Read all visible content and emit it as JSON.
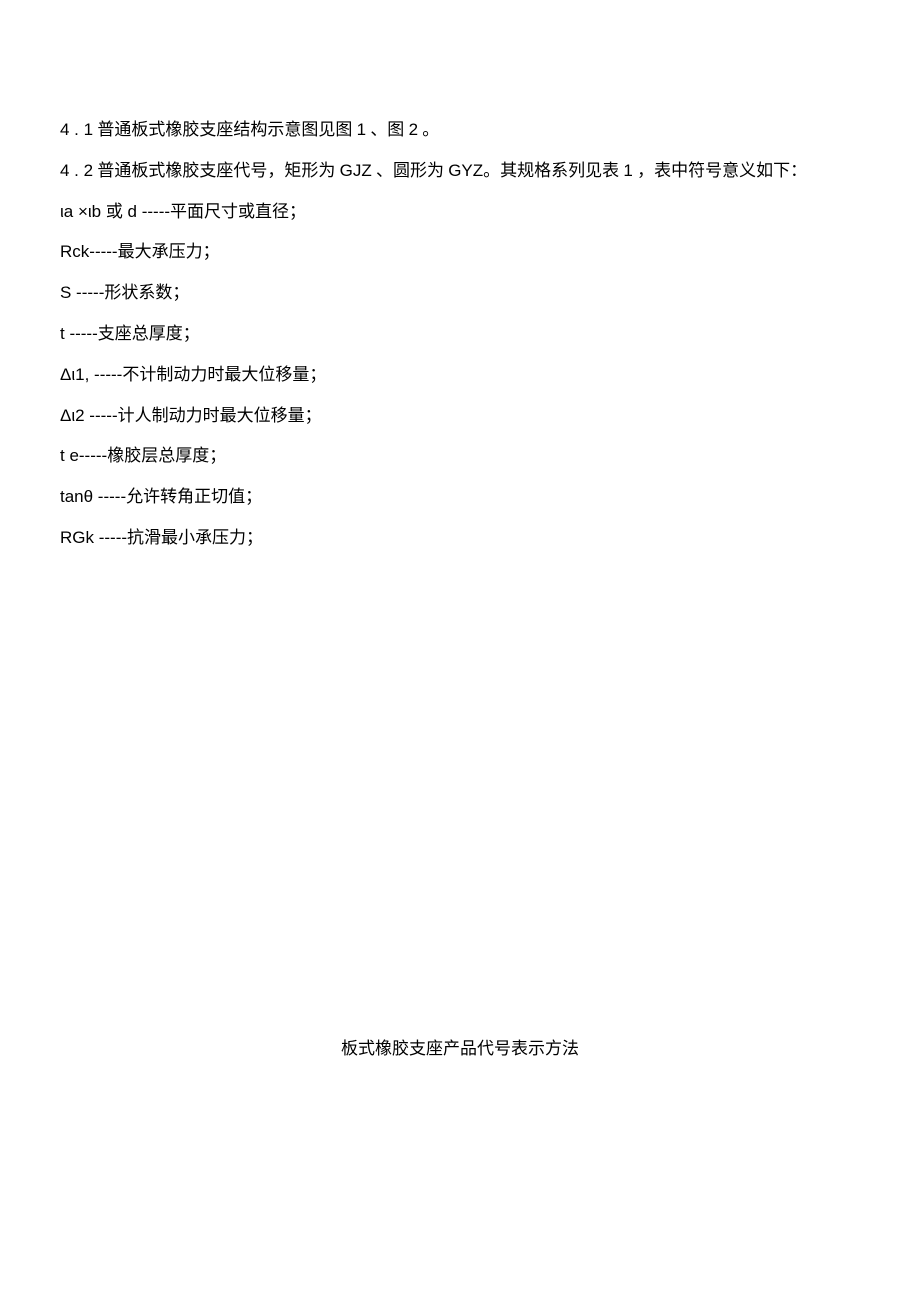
{
  "section_4_1": {
    "number": "4 . 1",
    "text_before": " 普通板式橡胶支座结构示意图见图 ",
    "fig1": "1",
    "separator": " 、图 ",
    "fig2": "2",
    "period": " 。"
  },
  "section_4_2": {
    "number": "4 . 2",
    "text_before": " 普通板式橡胶支座代号，矩形为 ",
    "code1": "GJZ",
    "mid1": " 、圆形为 ",
    "code2": "GYZ",
    "mid2": "。其规格系列见表 ",
    "table_num": "1",
    "after": " ，表中符号意义如下："
  },
  "definitions": [
    {
      "symbol": "ιa ×ιb 或 d -----",
      "desc": "平面尺寸或直径；"
    },
    {
      "symbol": "Rck-----",
      "desc": "最大承压力；"
    },
    {
      "symbol": "S -----",
      "desc": "形状系数；"
    },
    {
      "symbol": "t -----",
      "desc": "支座总厚度；"
    },
    {
      "symbol": "Δι1, -----",
      "desc": "不计制动力时最大位移量；"
    },
    {
      "symbol": "Δι2 -----",
      "desc": "计人制动力时最大位移量；"
    },
    {
      "symbol": "t e-----",
      "desc": "橡胶层总厚度；"
    },
    {
      "symbol": "tanθ -----",
      "desc": "允许转角正切值；"
    },
    {
      "symbol": "RGk -----",
      "desc": "抗滑最小承压力；"
    }
  ],
  "footer_title": "板式橡胶支座产品代号表示方法"
}
